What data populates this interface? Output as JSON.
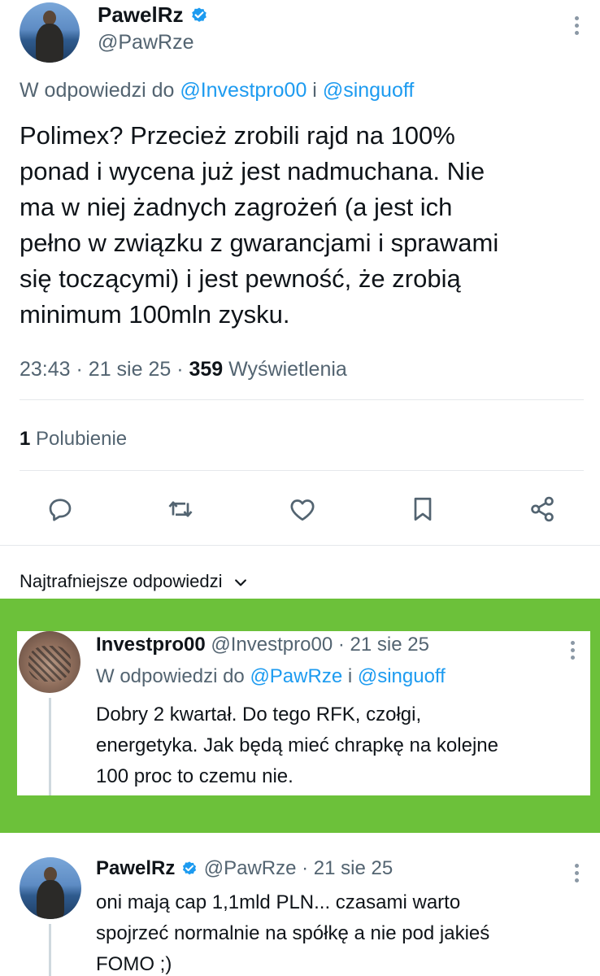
{
  "main_tweet": {
    "author_name": "PawelRz",
    "author_handle": "@PawRze",
    "reply_prefix": "W odpowiedzi do ",
    "reply_to_1": "@Investpro00",
    "reply_and": " i ",
    "reply_to_2": "@singuoff",
    "text_lines": [
      "Polimex? Przecież zrobili rajd na 100%",
      "ponad i wycena już jest nadmuchana. Nie",
      "ma w niej żadnych zagrożeń (a jest ich",
      "pełno w związku z gwarancjami i sprawami",
      "się toczącymi) i jest pewność, że zrobią",
      "minimum 100mln zysku."
    ],
    "time": "23:43",
    "sep": "·",
    "date": "21 sie 25",
    "views_count": "359",
    "views_label": "Wyświetlenia",
    "likes_count": "1",
    "likes_label": "Polubienie"
  },
  "actions": [
    {
      "icon": "reply-icon"
    },
    {
      "icon": "retweet-icon"
    },
    {
      "icon": "like-icon"
    },
    {
      "icon": "bookmark-icon"
    },
    {
      "icon": "share-icon"
    }
  ],
  "sort": {
    "label": "Najtrafniejsze odpowiedzi",
    "icon": "chevron-down-icon"
  },
  "reply1": {
    "author_name": "Investpro00",
    "author_handle": "@Investpro00",
    "sep": "·",
    "date": "21 sie 25",
    "reply_prefix": "W odpowiedzi do ",
    "reply_to_1": "@PawRze",
    "reply_and": " i ",
    "reply_to_2": "@singuoff",
    "text_lines": [
      "Dobry 2 kwartał. Do tego RFK, czołgi,",
      "energetyka. Jak będą mieć chrapkę na kolejne",
      "100 proc to czemu nie."
    ]
  },
  "reply2": {
    "author_name": "PawelRz",
    "author_handle": "@PawRze",
    "sep": "·",
    "date": "21 sie 25",
    "text_lines": [
      "oni mają cap 1,1mld PLN... czasami warto",
      "spojrzeć normalnie na spółkę a nie pod jakieś",
      "FOMO ;)"
    ]
  },
  "colors": {
    "highlight_green": "#6cc13a",
    "link_blue": "#1d9bf0",
    "grey_text": "#536471"
  }
}
